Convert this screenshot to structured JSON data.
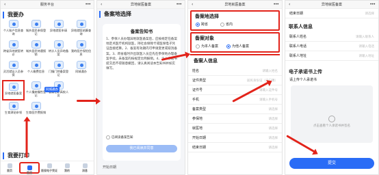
{
  "phone1": {
    "title": "服务平台",
    "section1": "我要办",
    "apps": [
      "个人账户信息查询",
      "城乡居民参保登记",
      "异地就医申请",
      "异地就医结算查询",
      "跨省异地就医转诊",
      "城乡居民待遇报销",
      "转诊人员异地备案",
      "我的医疗保险信息",
      "灵活就业人员参保",
      "个人缴费信息",
      "门慢门特备案登记",
      "同城通办",
      "异地就医备案",
      "个人慢病慢性登记",
      "省属在职高校人员",
      "",
      "生育津贴申领",
      "生育医疗费报销",
      "",
      ""
    ],
    "badge": "同城通办",
    "section2": "我要打印",
    "tabs": [
      "首页",
      "医保",
      "医保电子凭证",
      "我的",
      "消息"
    ]
  },
  "phone2": {
    "title": "异地就医备案",
    "head": "备案地选择",
    "modal_title": "备案告知书",
    "notice": "1、参保人员办理异地就医备案后，应按规定在备案地定点医疗机构就医，持社会保障卡或医保电子凭证直接结算。2、备案有效期内可申请变更或取消备案。3、跨省临时外出就医人员应先在参保地办理备案手续，未备案的按规定比例报销。4、个人承诺书提交后不得随意撤回，请认真阅读本告知书并如实填写。",
    "check": "已阅读备案告知",
    "confirm": "我已阅读并同意",
    "footer": "开始日期"
  },
  "phone3": {
    "title": "异地就医备案",
    "loc_title": "备案地选择",
    "loc_opts": [
      "跨省",
      "省内"
    ],
    "obj_title": "备案对象",
    "obj_opts": [
      "为本人备案",
      "为他人备案"
    ],
    "person_title": "备案人信息",
    "fields": [
      "姓名",
      "证件类型",
      "证件号",
      "手机",
      "备案类型",
      "参保地",
      "就医地",
      "开始日期",
      "结束日期"
    ],
    "values": [
      "请输入姓名",
      "居民身份证（户口簿）",
      "请输入证件号",
      "请输入手机号",
      "请选择",
      "请选择",
      "请选择",
      "请选择",
      "请选择"
    ]
  },
  "phone4": {
    "title": "异地就医备案",
    "end_label": "结束日期",
    "end_value": "请选择",
    "contact_title": "联系人信息",
    "contact_fields": [
      "联系人姓名",
      "联系人电话",
      "联系人地址"
    ],
    "contact_values": [
      "请输入联系人",
      "请输入电话",
      "请输入地址"
    ],
    "pledge_title": "电子承诺书上传",
    "pledge_sub": "请上传个人承诺书",
    "pledge_hint": "点击查看个人承诺书并签名",
    "submit": "提交"
  }
}
